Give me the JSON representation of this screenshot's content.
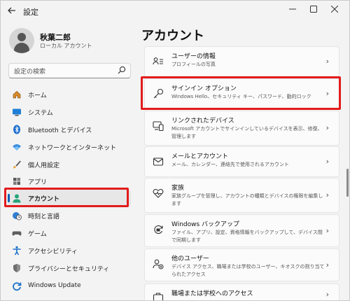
{
  "window": {
    "title": "設定",
    "back_icon": "back-arrow-icon"
  },
  "user": {
    "name": "秋葉二郎",
    "type": "ローカル アカウント"
  },
  "search": {
    "placeholder": "設定の検索"
  },
  "nav": [
    {
      "id": "home",
      "label": "ホーム",
      "icon": "home-icon",
      "active": false
    },
    {
      "id": "system",
      "label": "システム",
      "icon": "monitor-icon",
      "active": false
    },
    {
      "id": "bluetooth",
      "label": "Bluetooth とデバイス",
      "icon": "bluetooth-icon",
      "active": false
    },
    {
      "id": "network",
      "label": "ネットワークとインターネット",
      "icon": "wifi-icon",
      "active": false
    },
    {
      "id": "personalization",
      "label": "個人用設定",
      "icon": "brush-icon",
      "active": false
    },
    {
      "id": "apps",
      "label": "アプリ",
      "icon": "apps-icon",
      "active": false
    },
    {
      "id": "accounts",
      "label": "アカウント",
      "icon": "person-icon",
      "active": true
    },
    {
      "id": "time",
      "label": "時刻と言語",
      "icon": "clock-globe-icon",
      "active": false
    },
    {
      "id": "gaming",
      "label": "ゲーム",
      "icon": "controller-icon",
      "active": false
    },
    {
      "id": "accessibility",
      "label": "アクセシビリティ",
      "icon": "accessibility-icon",
      "active": false
    },
    {
      "id": "privacy",
      "label": "プライバシーとセキュリティ",
      "icon": "shield-icon",
      "active": false
    },
    {
      "id": "update",
      "label": "Windows Update",
      "icon": "update-icon",
      "active": false
    }
  ],
  "main": {
    "title": "アカウント",
    "cards": [
      {
        "id": "your-info",
        "title": "ユーザーの情報",
        "desc": "プロフィールの写真",
        "icon": "person-list-icon"
      },
      {
        "id": "signin",
        "title": "サインイン オプション",
        "desc": "Windows Hello、セキュリティ キー、パスワード、動的ロック",
        "icon": "key-icon"
      },
      {
        "id": "linked-devices",
        "title": "リンクされたデバイス",
        "desc": "Microsoft アカウントでサインインしているデバイスを表示、修復、管理します",
        "icon": "devices-icon"
      },
      {
        "id": "email",
        "title": "メールとアカウント",
        "desc": "メール、カレンダー、連絡先で使用されるアカウント",
        "icon": "mail-icon"
      },
      {
        "id": "family",
        "title": "家族",
        "desc": "家族グループを管理し、アカウントの種類とデバイスの権限を編集します",
        "icon": "heart-icon"
      },
      {
        "id": "backup",
        "title": "Windows バックアップ",
        "desc": "ファイル、アプリ、設定、資格情報をバックアップして、デバイス間で同期します",
        "icon": "backup-icon"
      },
      {
        "id": "other-users",
        "title": "他のユーザー",
        "desc": "デバイス アクセス、職場または学校のユーザー、キオスクの割り当てられたアクセス",
        "icon": "people-add-icon"
      },
      {
        "id": "work-school",
        "title": "職場または学校へのアクセス",
        "desc": "",
        "icon": "briefcase-icon"
      }
    ]
  },
  "colors": {
    "accent": "#005fb8",
    "highlight": "#e31b1b"
  }
}
